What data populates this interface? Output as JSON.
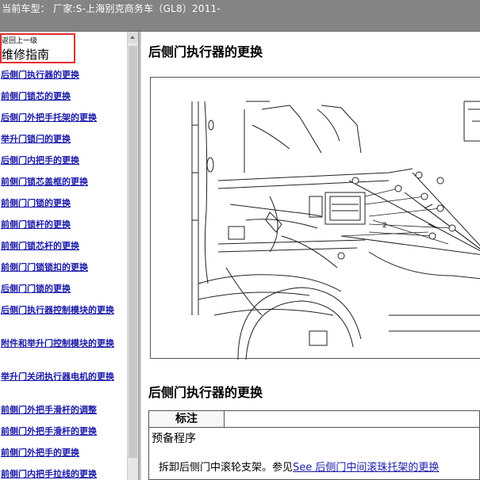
{
  "titlebar": {
    "text": "当前车型： 厂家:S-上海别克商务车（GL8）2011-"
  },
  "sidebar": {
    "back_label": "返回上一级",
    "guide_title": "维修指南",
    "items": [
      {
        "label": "后侧门执行器的更换"
      },
      {
        "label": "前侧门锁芯的更换"
      },
      {
        "label": "后侧门外把手托架的更换"
      },
      {
        "label": "举升门锁闩的更换"
      },
      {
        "label": "后侧门内把手的更换"
      },
      {
        "label": "前侧门锁芯盖框的更换"
      },
      {
        "label": "前侧门门锁的更换"
      },
      {
        "label": "前侧门锁杆的更换"
      },
      {
        "label": "前侧门锁芯杆的更换"
      },
      {
        "label": "前侧门门锁锁扣的更换"
      },
      {
        "label": "后侧门门锁的更换"
      },
      {
        "label": "后侧门执行器控制模块的更换"
      },
      {
        "label": "附件和举升门控制模块的更换"
      },
      {
        "label": "举升门关闭执行器电机的更换"
      },
      {
        "label": "前侧门外把手滑杆的调整"
      },
      {
        "label": "前侧门外把手滑杆的更换"
      },
      {
        "label": "前侧门外把手的更换"
      },
      {
        "label": "前侧门内把手拉线的更换"
      }
    ]
  },
  "content": {
    "heading1": "后侧门执行器的更换",
    "callout_2": "2",
    "heading2": "后侧门执行器的更换",
    "note_header": "标注",
    "prep_label": "预备程序",
    "step_text": "拆卸后侧门中滚轮支架。参见",
    "step_link": "See 后侧门中间滚珠托架的更换"
  }
}
